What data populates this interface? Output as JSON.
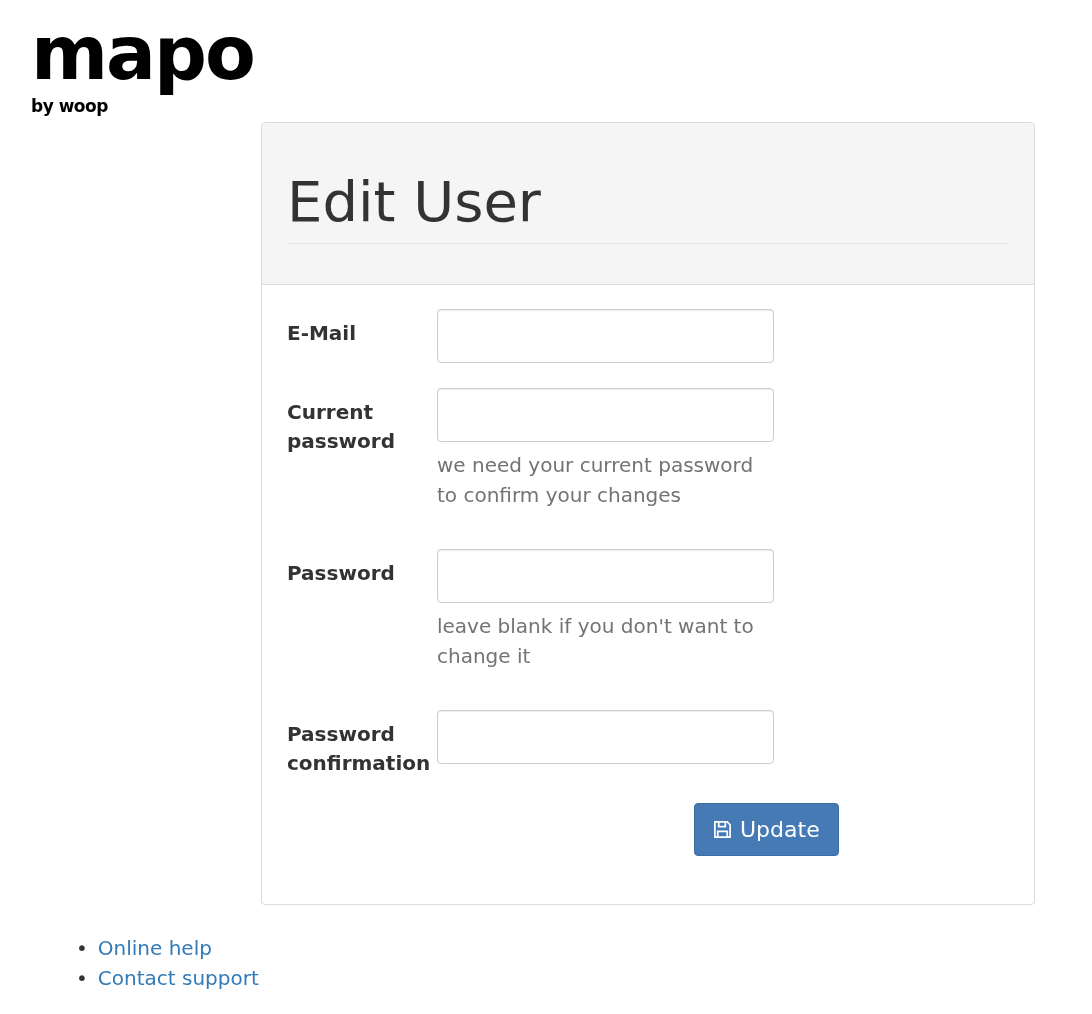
{
  "logo": {
    "name": "mapo",
    "tagline": "by woop"
  },
  "card": {
    "title": "Edit User",
    "fields": [
      {
        "label": "E-Mail"
      },
      {
        "label": "Current password",
        "help": "we need your current password to confirm your changes"
      },
      {
        "label": "Password",
        "help": "leave blank if you don't want to change it"
      },
      {
        "label": "Password confirmation"
      }
    ],
    "submit": {
      "label": "Update"
    }
  },
  "footer_links": [
    {
      "bullet": "•",
      "label": "Online help"
    },
    {
      "bullet": "•",
      "label": "Contact support"
    }
  ]
}
